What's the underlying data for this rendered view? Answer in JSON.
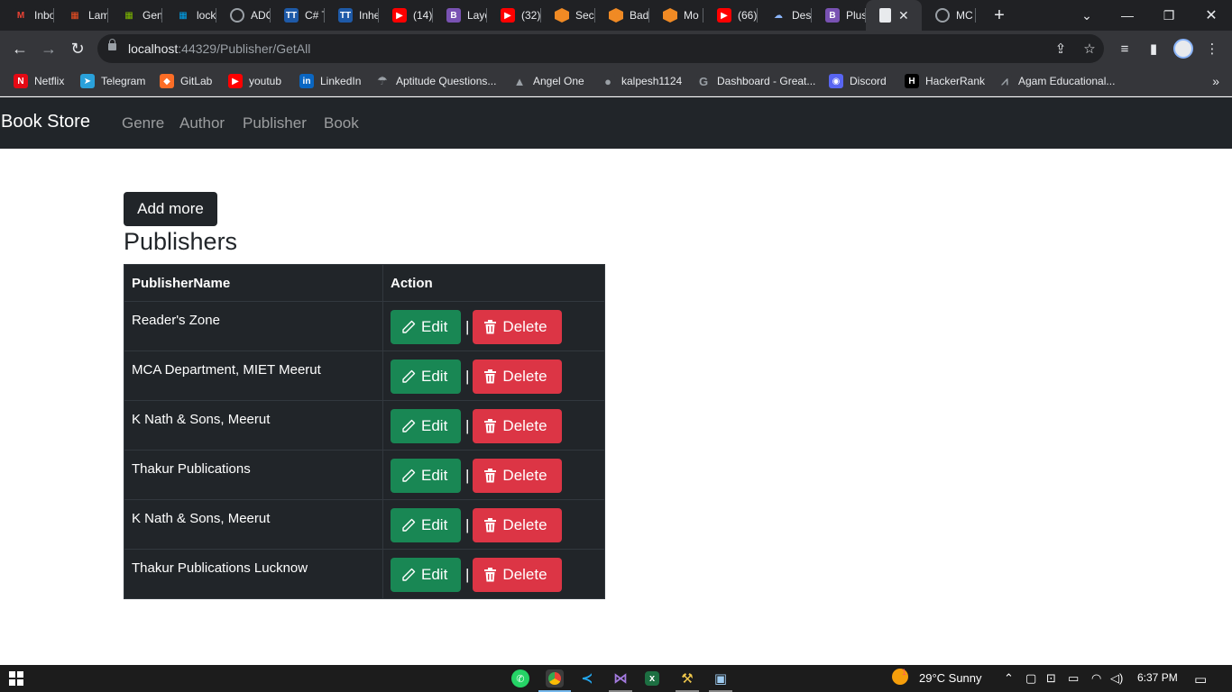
{
  "browser": {
    "tabs": [
      {
        "label": "Inbox",
        "icon": "gmail-icon",
        "color": "#202124",
        "glyph": "M",
        "glyph_color": "#ea4335"
      },
      {
        "label": "Lam",
        "icon": "microsoft-icon",
        "color": "#202124",
        "glyph": "▦",
        "glyph_color": "#f25022"
      },
      {
        "label": "Gen",
        "icon": "microsoft-icon",
        "color": "#202124",
        "glyph": "▦",
        "glyph_color": "#7fba00"
      },
      {
        "label": "lock",
        "icon": "microsoft-icon",
        "color": "#202124",
        "glyph": "▦",
        "glyph_color": "#00a4ef"
      },
      {
        "label": "ADO",
        "icon": "globe-icon",
        "color": "#5f6368",
        "glyph": "",
        "glyph_color": "#fff"
      },
      {
        "label": "C# T",
        "icon": "tutorialsteacher-icon",
        "color": "#1e5aa8",
        "glyph": "TT",
        "glyph_color": "#fff"
      },
      {
        "label": "Inhe",
        "icon": "tutorialsteacher-icon",
        "color": "#1e5aa8",
        "glyph": "TT",
        "glyph_color": "#fff"
      },
      {
        "label": "(14)",
        "icon": "youtube-icon",
        "color": "#ff0000",
        "glyph": "▶",
        "glyph_color": "#fff"
      },
      {
        "label": "Layo",
        "icon": "bootstrap-icon",
        "color": "#7952b3",
        "glyph": "B",
        "glyph_color": "#fff"
      },
      {
        "label": "(32)",
        "icon": "youtube-icon",
        "color": "#ff0000",
        "glyph": "▶",
        "glyph_color": "#fff"
      },
      {
        "label": "Sec",
        "icon": "box-icon",
        "color": "#f08a24",
        "glyph": "",
        "glyph_color": "#fff"
      },
      {
        "label": "Bad",
        "icon": "box-icon",
        "color": "#f08a24",
        "glyph": "",
        "glyph_color": "#fff"
      },
      {
        "label": "Mo",
        "icon": "box-icon",
        "color": "#f08a24",
        "glyph": "",
        "glyph_color": "#fff"
      },
      {
        "label": "(66)",
        "icon": "youtube-icon",
        "color": "#ff0000",
        "glyph": "▶",
        "glyph_color": "#fff"
      },
      {
        "label": "Des",
        "icon": "cloud-icon",
        "color": "#202124",
        "glyph": "☁",
        "glyph_color": "#8ab4f8"
      },
      {
        "label": "Plus",
        "icon": "bootstrap-icon",
        "color": "#7952b3",
        "glyph": "B",
        "glyph_color": "#fff"
      }
    ],
    "active_tab": {
      "label": "",
      "icon": "page-icon"
    },
    "last_tab": {
      "label": "MC",
      "icon": "globe-icon"
    },
    "new_tab": "+",
    "url_host": "localhost",
    "url_rest": ":44329/Publisher/GetAll",
    "bookmarks": [
      {
        "label": "Netflix",
        "icon": "netflix-icon",
        "color": "#e50914",
        "glyph": "N"
      },
      {
        "label": "Telegram",
        "icon": "telegram-icon",
        "color": "#2aa1da",
        "glyph": "➤"
      },
      {
        "label": "GitLab",
        "icon": "gitlab-icon",
        "color": "#fc6d26",
        "glyph": "◆"
      },
      {
        "label": "youtub",
        "icon": "youtube-icon",
        "color": "#ff0000",
        "glyph": "▶"
      },
      {
        "label": "LinkedIn",
        "icon": "linkedin-icon",
        "color": "#0a66c2",
        "glyph": "in"
      },
      {
        "label": "Aptitude Questions...",
        "icon": "umbrella-icon",
        "color": "#35363a",
        "glyph": "☂"
      },
      {
        "label": "Angel One",
        "icon": "angelone-icon",
        "color": "#35363a",
        "glyph": "▲"
      },
      {
        "label": "kalpesh1124",
        "icon": "github-icon",
        "color": "#35363a",
        "glyph": "●"
      },
      {
        "label": "Dashboard - Great...",
        "icon": "greatlearning-icon",
        "color": "#35363a",
        "glyph": "G"
      },
      {
        "label": "Discord",
        "icon": "discord-icon",
        "color": "#5865f2",
        "glyph": "◉"
      },
      {
        "label": "HackerRank",
        "icon": "hackerrank-icon",
        "color": "#000000",
        "glyph": "H"
      },
      {
        "label": "Agam Educational...",
        "icon": "agam-icon",
        "color": "#35363a",
        "glyph": "⩘"
      }
    ],
    "bookmarks_more": "»"
  },
  "app": {
    "brand": "Book Store",
    "nav": [
      "Genre",
      "Author",
      "Publisher",
      "Book"
    ],
    "add_button": "Add more",
    "heading": "Publishers",
    "table": {
      "headers": [
        "PublisherName",
        "Action"
      ],
      "rows": [
        {
          "name": "Reader's Zone"
        },
        {
          "name": "MCA Department, MIET Meerut"
        },
        {
          "name": "K Nath & Sons, Meerut"
        },
        {
          "name": "Thakur Publications"
        },
        {
          "name": "K Nath & Sons, Meerut"
        },
        {
          "name": "Thakur Publications Lucknow"
        }
      ],
      "edit_label": "Edit",
      "delete_label": "Delete",
      "separator": "|"
    }
  },
  "taskbar": {
    "apps": [
      "whatsapp-icon",
      "chrome-icon",
      "vscode-icon",
      "visualstudio-icon",
      "excel-icon",
      "filezilla-icon",
      "remote-desktop-icon"
    ],
    "weather_badge": "1",
    "weather": "29°C  Sunny",
    "time": "6:37 PM"
  },
  "colors": {
    "navbar": "#212529",
    "edit": "#198754",
    "delete": "#dc3545",
    "table": "#212529"
  }
}
